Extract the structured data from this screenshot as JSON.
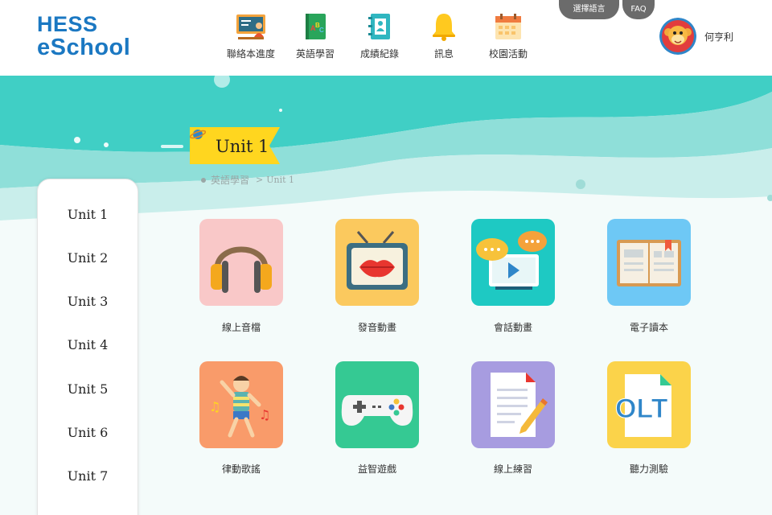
{
  "header": {
    "logo_line1": "HESS",
    "logo_line2": "eSchool",
    "nav": [
      {
        "label": "聯絡本進度",
        "icon": "blackboard-icon"
      },
      {
        "label": "英語學習",
        "icon": "abc-book-icon"
      },
      {
        "label": "成績紀錄",
        "icon": "address-book-icon"
      },
      {
        "label": "訊息",
        "icon": "bell-icon"
      },
      {
        "label": "校園活動",
        "icon": "calendar-icon"
      }
    ],
    "language_button": "選擇語言",
    "faq_button": "FAQ",
    "username": "何亨利"
  },
  "page": {
    "title": "Unit 1",
    "breadcrumb_parent": "英語學習",
    "breadcrumb_separator": ">",
    "breadcrumb_current": "Unit 1"
  },
  "sidebar": {
    "items": [
      "Unit 1",
      "Unit 2",
      "Unit 3",
      "Unit 4",
      "Unit 5",
      "Unit 6",
      "Unit 7"
    ]
  },
  "tiles": [
    {
      "label": "線上音檔",
      "icon": "headphones-icon",
      "color": "#f9c8c8"
    },
    {
      "label": "發音動畫",
      "icon": "tv-lips-icon",
      "color": "#fbc95e"
    },
    {
      "label": "會話動畫",
      "icon": "chat-video-icon",
      "color": "#1ec9c3"
    },
    {
      "label": "電子讀本",
      "icon": "open-book-icon",
      "color": "#6ec8f5"
    },
    {
      "label": "律動歌謠",
      "icon": "dancing-kid-icon",
      "color": "#f99b6a"
    },
    {
      "label": "益智遊戲",
      "icon": "gamepad-icon",
      "color": "#35c993"
    },
    {
      "label": "線上練習",
      "icon": "worksheet-pencil-icon",
      "color": "#a79ce0"
    },
    {
      "label": "聽力測驗",
      "icon": "olt-document-icon",
      "color": "#fbd34a"
    }
  ],
  "colors": {
    "brand": "#1b78c2",
    "hero_teal": "#40cfc5",
    "ribbon_yellow": "#ffd61f"
  }
}
